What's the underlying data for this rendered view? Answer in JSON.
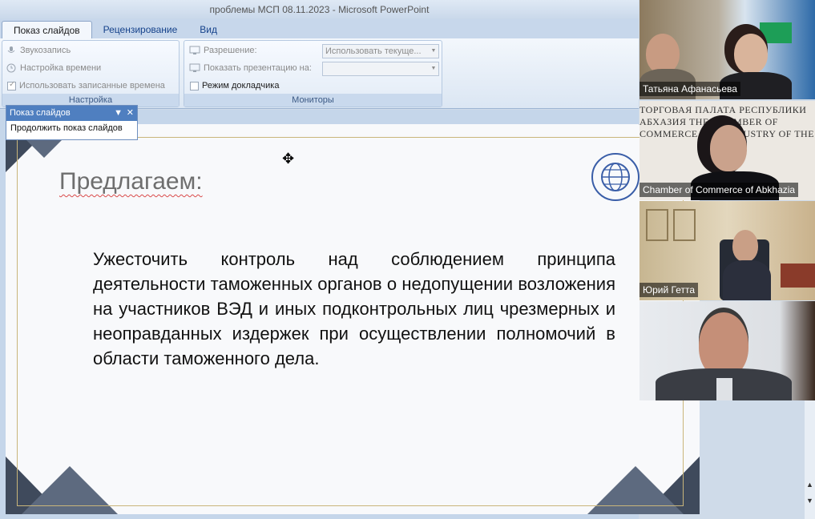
{
  "window": {
    "title": "проблемы МСП 08.11.2023 - Microsoft PowerPoint"
  },
  "tabs": [
    {
      "label": "Показ слайдов",
      "active": true
    },
    {
      "label": "Рецензирование",
      "active": false
    },
    {
      "label": "Вид",
      "active": false
    }
  ],
  "ribbon": {
    "setup": {
      "group_label": "Настройка",
      "sound_label": "Звукозапись",
      "timing_label": "Настройка времени",
      "use_timings_label": "Использовать записанные времена"
    },
    "monitors": {
      "group_label": "Мониторы",
      "resolution_label": "Разрешение:",
      "resolution_value": "Использовать текуще...",
      "show_on_label": "Показать презентацию на:",
      "show_on_value": "",
      "presenter_view_label": "Режим докладчика"
    }
  },
  "floating_toolbar": {
    "title": "Показ слайдов",
    "item_label": "Продолжить показ слайдов"
  },
  "slide": {
    "heading": "Предлагаем:",
    "body": "Ужесточить контроль над соблюдением принципа деятельности таможенных органов о недопущении возложения на участников ВЭД и иных подконтрольных лиц чрезмерных и неоправданных издержек при осуществлении полномочий в области таможенного дела."
  },
  "participants": [
    {
      "name": "Татьяна Афанасьева"
    },
    {
      "name": "Chamber of Commerce of Abkhazia",
      "backdrop_text": "ТОРГОВАЯ ПАЛАТА РЕСПУБЛИКИ АБХАЗИЯ  THE CHAMBER OF COMMERCE AND INDUSTRY OF THE"
    },
    {
      "name": "Юрий Гетта"
    },
    {
      "name": ""
    }
  ],
  "colors": {
    "ribbon_tab_text": "#15428b",
    "slide_corner": "#3f4a5c",
    "slide_border": "#c9b57a",
    "floating_title_bg": "#4f7fc0"
  }
}
